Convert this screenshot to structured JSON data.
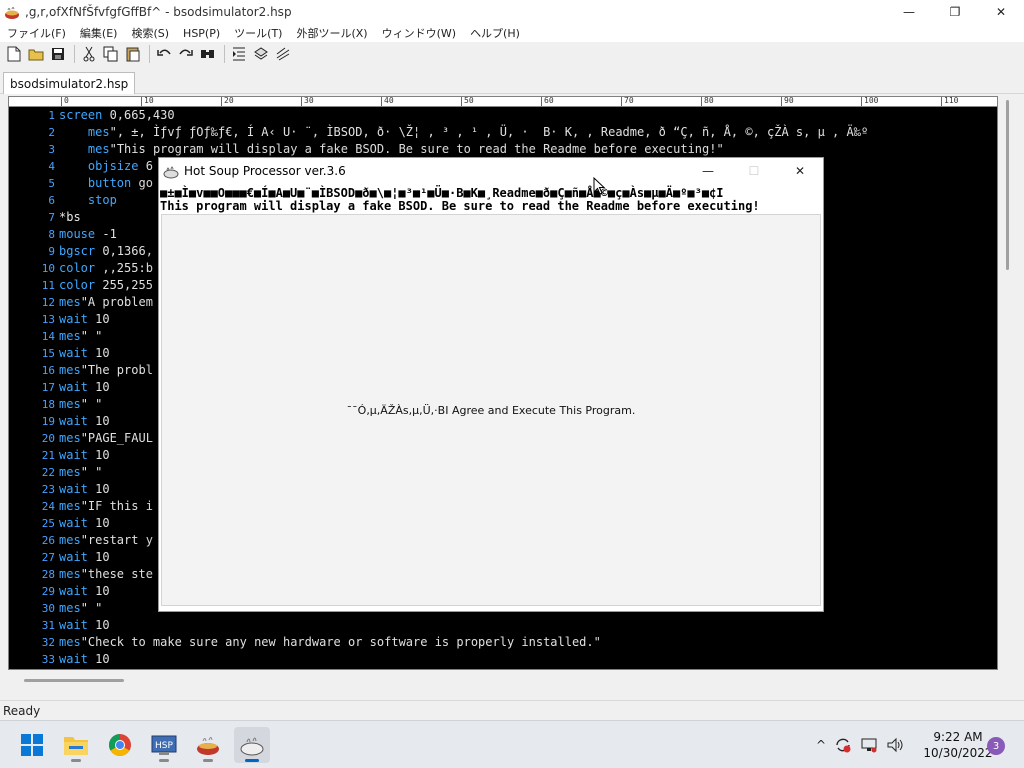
{
  "window": {
    "title": ",g,r,ofXfNfŠfvfgfGffBf^ - bsodsimulator2.hsp",
    "minimize_glyph": "—",
    "maximize_glyph": "❐",
    "close_glyph": "✕"
  },
  "menu": [
    "ファイル(F)",
    "編集(E)",
    "検索(S)",
    "HSP(P)",
    "ツール(T)",
    "外部ツール(X)",
    "ウィンドウ(W)",
    "ヘルプ(H)"
  ],
  "toolbar": [
    "new-file-icon",
    "open-folder-icon",
    "save-icon",
    "cut-icon",
    "copy-icon",
    "paste-icon",
    "undo-icon",
    "redo-icon",
    "find-icon",
    "indent-icon",
    "compile-icon",
    "run-icon"
  ],
  "tab": {
    "label": "bsodsimulator2.hsp"
  },
  "ruler": [
    "0",
    "10",
    "20",
    "30",
    "40",
    "50",
    "60",
    "70",
    "80",
    "90",
    "100",
    "110"
  ],
  "code_lines": [
    {
      "n": "1",
      "text": "screen 0,665,430"
    },
    {
      "n": "2",
      "text": "    mes\", ±, Ìƒvƒ ƒOƒ‰ƒ€, Í A‹ U· ¨, ÌBSOD, ð· \\Ž¦ , ³ , ¹ , Ü, ·  B· K, , Readme, ð “Ç, ñ, Å, ©, çŽÀ s, µ , Ä‰º"
    },
    {
      "n": "3",
      "text": "    mes\"This program will display a fake BSOD. Be sure to read the Readme before executing!\""
    },
    {
      "n": "4",
      "text": "    objsize 6"
    },
    {
      "n": "5",
      "text": "    button go"
    },
    {
      "n": "6",
      "text": "    stop"
    },
    {
      "n": "7",
      "text": "*bs"
    },
    {
      "n": "8",
      "text": "mouse -1"
    },
    {
      "n": "9",
      "text": "bgscr 0,1366,"
    },
    {
      "n": "10",
      "text": "color ,,255:b"
    },
    {
      "n": "11",
      "text": "color 255,255"
    },
    {
      "n": "12",
      "text": "mes\"A problem"
    },
    {
      "n": "13",
      "text": "wait 10"
    },
    {
      "n": "14",
      "text": "mes\" \""
    },
    {
      "n": "15",
      "text": "wait 10"
    },
    {
      "n": "16",
      "text": "mes\"The probl"
    },
    {
      "n": "17",
      "text": "wait 10"
    },
    {
      "n": "18",
      "text": "mes\" \""
    },
    {
      "n": "19",
      "text": "wait 10"
    },
    {
      "n": "20",
      "text": "mes\"PAGE_FAUL"
    },
    {
      "n": "21",
      "text": "wait 10"
    },
    {
      "n": "22",
      "text": "mes\" \""
    },
    {
      "n": "23",
      "text": "wait 10"
    },
    {
      "n": "24",
      "text": "mes\"IF this i"
    },
    {
      "n": "25",
      "text": "wait 10"
    },
    {
      "n": "26",
      "text": "mes\"restart y"
    },
    {
      "n": "27",
      "text": "wait 10"
    },
    {
      "n": "28",
      "text": "mes\"these ste"
    },
    {
      "n": "29",
      "text": "wait 10"
    },
    {
      "n": "30",
      "text": "mes\" \""
    },
    {
      "n": "31",
      "text": "wait 10"
    },
    {
      "n": "32",
      "text": "mes\"Check to make sure any new hardware or software is properly installed.\""
    },
    {
      "n": "33",
      "text": "wait 10"
    }
  ],
  "dialog": {
    "title": "Hot Soup Processor ver.3.6",
    "line1": "■±■Ì■v■■O■■■€■Í■A■U■¨■ÌBSOD■ð■\\■¦■³■¹■Ü■·B■K■¸Readme■ð■Ç■ñ■Å■©■ç■Às■µ■Ä■º■³■¢I",
    "line2": "This program will display a fake BSOD. Be sure to read the Readme before executing!",
    "button_label": "¯¯Ó,µ,ÄŽÀs,µ,Ü,·BI Agree and Execute This Program."
  },
  "status": {
    "text": "Ready"
  },
  "taskbar": {
    "apps": [
      "windows-start-icon",
      "file-explorer-icon",
      "chrome-icon",
      "hsp-assistant-icon",
      "hsp-editor-icon",
      "hot-soup-processor-icon"
    ],
    "time": "9:22 AM",
    "date": "10/30/2022",
    "notification_count": "3"
  }
}
